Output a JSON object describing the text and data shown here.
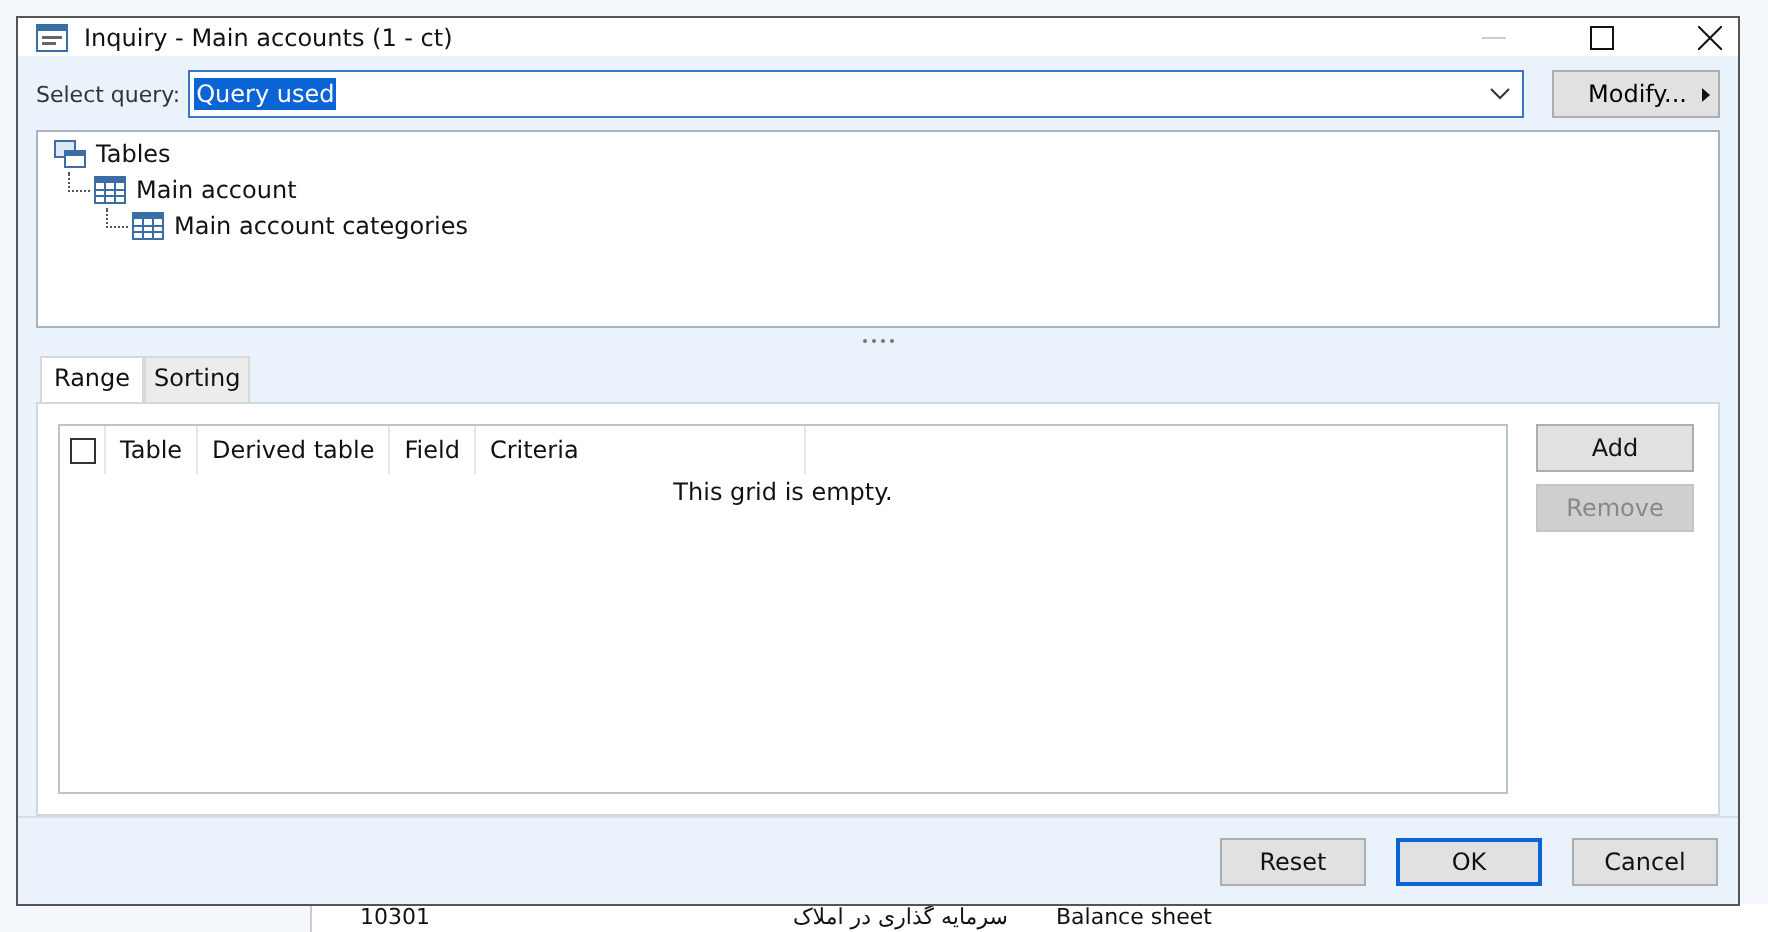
{
  "window": {
    "title": "Inquiry - Main accounts (1 - ct)"
  },
  "query": {
    "label": "Select query:",
    "value": "Query used",
    "value_selected": true
  },
  "modify_button": "Modify...",
  "tree": [
    {
      "label": "Tables",
      "kind": "group",
      "children": [
        {
          "label": "Main account",
          "kind": "table",
          "children": [
            {
              "label": "Main account categories",
              "kind": "table"
            }
          ]
        }
      ]
    }
  ],
  "tabs": [
    {
      "label": "Range",
      "selected": true
    },
    {
      "label": "Sorting",
      "selected": false
    }
  ],
  "grid": {
    "select_all_checked": false,
    "columns": [
      "Table",
      "Derived table",
      "Field",
      "Criteria"
    ],
    "empty_message": "This grid is empty."
  },
  "side_buttons": [
    {
      "label": "Add",
      "disabled": false
    },
    {
      "label": "Remove",
      "disabled": true
    }
  ],
  "footer_buttons": [
    {
      "label": "Reset",
      "default": false
    },
    {
      "label": "OK",
      "default": true
    },
    {
      "label": "Cancel",
      "default": false
    }
  ],
  "background_row": [
    "10301",
    "سرمایه گذاری در املاک",
    "Balance sheet"
  ]
}
